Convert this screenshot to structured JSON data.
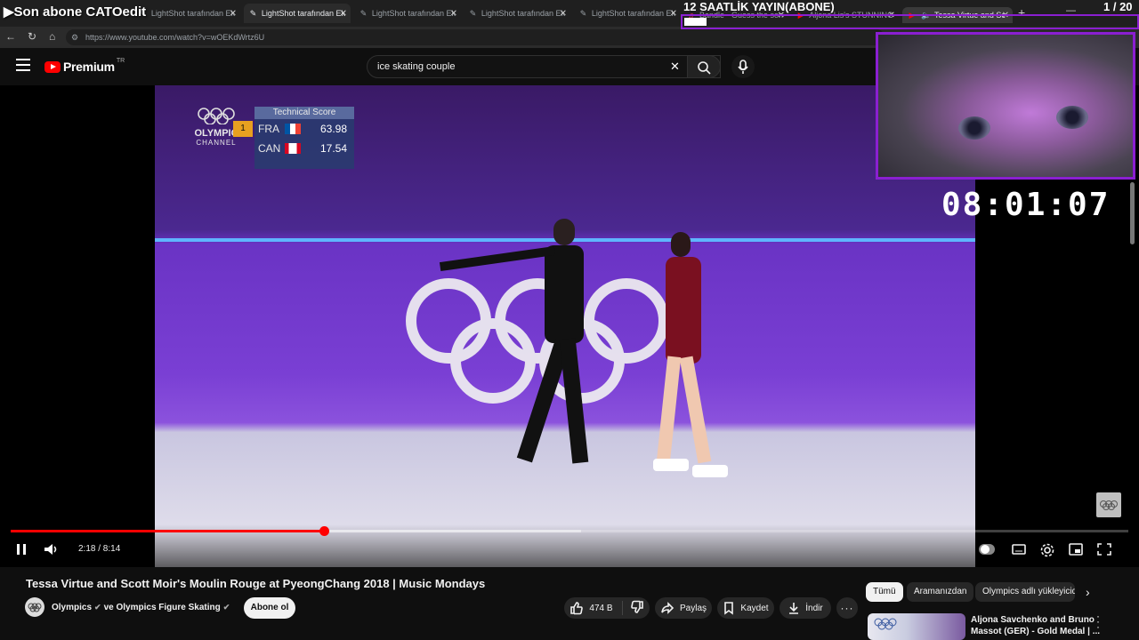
{
  "overlay": {
    "title": "Son abone CATOedit",
    "stream_title": "12 SAATLİK YAYIN(ABONE)",
    "stream_count": "1 / 20",
    "stream_progress": 0.05,
    "clock": "08:01:07"
  },
  "tabs": [
    {
      "label": "LightShot tarafından Ek",
      "active": false
    },
    {
      "label": "LightShot tarafından Ek",
      "active": true
    },
    {
      "label": "LightShot tarafından Ek",
      "active": false
    },
    {
      "label": "LightShot tarafından Ek",
      "active": false
    },
    {
      "label": "LightShot tarafından Ek",
      "active": false
    },
    {
      "label": "Bandle - Guess the son",
      "active": false
    },
    {
      "label": "Aljona Lis's STUNNING",
      "active": false
    },
    {
      "label": "Tessa Virtue and Sc",
      "active": false
    }
  ],
  "browser": {
    "url": "https://www.youtube.com/watch?v=wOEKdWrtz6U"
  },
  "youtube": {
    "logo_label": "Premium",
    "logo_region": "TR",
    "search_value": "ice skating couple"
  },
  "scoreboard": {
    "logo_line1": "OLYMPIC",
    "logo_line2": "CHANNEL",
    "header": "Technical Score",
    "rows": [
      {
        "rank": "1",
        "country": "FRA",
        "score": "63.98"
      },
      {
        "rank": "",
        "country": "CAN",
        "score": "17.54"
      }
    ]
  },
  "player": {
    "time": "2:18 / 8:14",
    "progress": 0.28,
    "buffered": 0.51
  },
  "video_info": {
    "title": "Tessa Virtue and Scott Moir's Moulin Rouge at PyeongChang 2018 | Music Mondays",
    "channel": "Olympics",
    "collab": "ve Olympics Figure Skating",
    "subscribe": "Abone ol",
    "likes": "474 B",
    "share": "Paylaş",
    "save": "Kaydet",
    "download": "İndir"
  },
  "chips": [
    "Tümü",
    "Aramanızdan",
    "Olympics adlı yükleyicid"
  ],
  "recommendation": {
    "title_line1": "Aljona Savchenko and Bruno",
    "title_line2": "Massot (GER) - Gold Medal | ..."
  },
  "colors": {
    "accent_red": "#ff0000",
    "overlay_purple": "#8a1fd1"
  }
}
